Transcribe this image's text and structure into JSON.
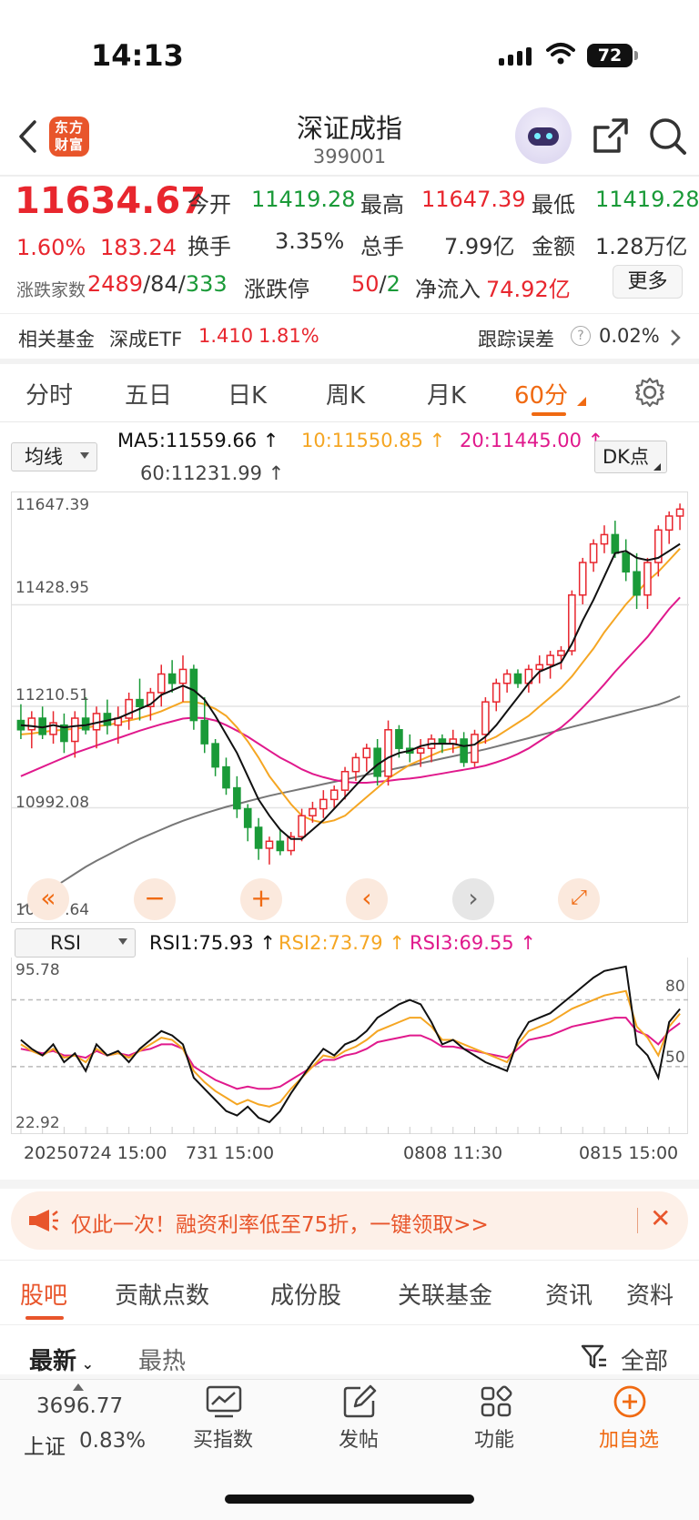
{
  "status": {
    "time": "14:13",
    "battery": "72"
  },
  "nav": {
    "title": "深证成指",
    "code": "399001",
    "logo_line1": "东方",
    "logo_line2": "财富"
  },
  "quote": {
    "price": "11634.67",
    "pct": "1.60%",
    "chg": "183.24",
    "open_label": "今开",
    "open": "11419.28",
    "high_label": "最高",
    "high": "11647.39",
    "low_label": "最低",
    "low": "11419.28",
    "turnover_label": "换手",
    "turnover": "3.35%",
    "volume_label": "总手",
    "volume": "7.99亿",
    "amount_label": "金额",
    "amount": "1.28万亿",
    "breadth_label": "涨跌家数",
    "up": "2489",
    "flat": "84",
    "down": "333",
    "limit_label": "涨跌停",
    "limit_up": "50",
    "limit_down": "2",
    "inflow_label": "净流入",
    "inflow": "74.92亿",
    "more": "更多"
  },
  "fund": {
    "label": "相关基金",
    "name": "深成ETF",
    "price": "1.410",
    "pct": "1.81%",
    "track_label": "跟踪误差",
    "track": "0.02%"
  },
  "tabs": [
    "分时",
    "五日",
    "日K",
    "周K",
    "月K",
    "60分"
  ],
  "active_tab": 5,
  "ma": {
    "selector": "均线",
    "ma5": "MA5:11559.66",
    "ma10": "10:11550.85",
    "ma20": "20:11445.00",
    "ma60": "60:11231.99",
    "dk": "DK点"
  },
  "axis": {
    "y1": "11647.39",
    "y2": "11428.95",
    "y3": "11210.51",
    "y4": "10992.08",
    "y5": "10773.64"
  },
  "rsi": {
    "selector": "RSI",
    "rsi1": "RSI1:75.93",
    "rsi2": "RSI2:73.79",
    "rsi3": "RSI3:69.55",
    "max": "95.78",
    "min": "22.92",
    "level80": "80",
    "level50": "50"
  },
  "dates": {
    "d1": "20250724 15:00",
    "d2": "731 15:00",
    "d3": "0808 11:30",
    "d4": "0815 15:00"
  },
  "banner": {
    "text": "仅此一次！融资利率低至75折，一键领取>>"
  },
  "bottom_tabs": [
    "股吧",
    "贡献点数",
    "成份股",
    "关联基金",
    "资讯",
    "资料"
  ],
  "feed": {
    "latest": "最新",
    "hot": "最热",
    "all": "全部"
  },
  "bottombar": {
    "index_value": "3696.77",
    "index_name": "上证",
    "index_pct": "0.83%",
    "buy": "买指数",
    "post": "发帖",
    "func": "功能",
    "add": "加自选"
  },
  "colors": {
    "up": "#e8262e",
    "down": "#1a9a38",
    "accent": "#f06a12",
    "ma5": "#111111",
    "ma10": "#f5a623",
    "ma20": "#e0198c",
    "ma60": "#777777"
  },
  "chart_data": {
    "type": "candlestick",
    "price_range": [
      10773.64,
      11647.39
    ],
    "ohlc": [
      [
        11180,
        11215,
        11140,
        11160
      ],
      [
        11160,
        11200,
        11120,
        11185
      ],
      [
        11185,
        11210,
        11140,
        11150
      ],
      [
        11150,
        11200,
        11130,
        11175
      ],
      [
        11170,
        11195,
        11110,
        11135
      ],
      [
        11135,
        11200,
        11100,
        11185
      ],
      [
        11185,
        11230,
        11150,
        11160
      ],
      [
        11160,
        11210,
        11120,
        11195
      ],
      [
        11195,
        11225,
        11150,
        11170
      ],
      [
        11170,
        11210,
        11130,
        11185
      ],
      [
        11185,
        11240,
        11160,
        11225
      ],
      [
        11225,
        11270,
        11180,
        11210
      ],
      [
        11210,
        11250,
        11180,
        11240
      ],
      [
        11240,
        11300,
        11210,
        11280
      ],
      [
        11280,
        11310,
        11240,
        11260
      ],
      [
        11260,
        11320,
        11220,
        11290
      ],
      [
        11290,
        11300,
        11160,
        11180
      ],
      [
        11180,
        11230,
        11110,
        11130
      ],
      [
        11130,
        11140,
        11060,
        11080
      ],
      [
        11080,
        11100,
        11020,
        11035
      ],
      [
        11035,
        11060,
        10970,
        10990
      ],
      [
        10990,
        11000,
        10920,
        10950
      ],
      [
        10950,
        10970,
        10880,
        10905
      ],
      [
        10905,
        10930,
        10870,
        10920
      ],
      [
        10920,
        10945,
        10890,
        10900
      ],
      [
        10900,
        10940,
        10890,
        10930
      ],
      [
        10930,
        10990,
        10920,
        10975
      ],
      [
        10975,
        11005,
        10960,
        10990
      ],
      [
        10990,
        11030,
        10970,
        11010
      ],
      [
        11010,
        11040,
        10990,
        11030
      ],
      [
        11030,
        11080,
        11010,
        11070
      ],
      [
        11070,
        11110,
        11050,
        11100
      ],
      [
        11100,
        11130,
        11070,
        11120
      ],
      [
        11120,
        11140,
        11040,
        11060
      ],
      [
        11060,
        11180,
        11040,
        11160
      ],
      [
        11160,
        11170,
        11100,
        11120
      ],
      [
        11120,
        11150,
        11090,
        11110
      ],
      [
        11110,
        11140,
        11080,
        11120
      ],
      [
        11120,
        11150,
        11090,
        11140
      ],
      [
        11140,
        11150,
        11110,
        11130
      ],
      [
        11130,
        11160,
        11110,
        11140
      ],
      [
        11140,
        11155,
        11080,
        11090
      ],
      [
        11090,
        11160,
        11080,
        11150
      ],
      [
        11150,
        11230,
        11130,
        11220
      ],
      [
        11220,
        11270,
        11200,
        11260
      ],
      [
        11260,
        11290,
        11240,
        11280
      ],
      [
        11280,
        11290,
        11250,
        11260
      ],
      [
        11260,
        11300,
        11240,
        11290
      ],
      [
        11290,
        11320,
        11260,
        11300
      ],
      [
        11300,
        11330,
        11270,
        11320
      ],
      [
        11320,
        11340,
        11290,
        11330
      ],
      [
        11330,
        11460,
        11320,
        11450
      ],
      [
        11450,
        11530,
        11430,
        11520
      ],
      [
        11520,
        11570,
        11500,
        11560
      ],
      [
        11560,
        11600,
        11540,
        11580
      ],
      [
        11580,
        11610,
        11530,
        11540
      ],
      [
        11540,
        11570,
        11480,
        11500
      ],
      [
        11500,
        11540,
        11420,
        11450
      ],
      [
        11450,
        11530,
        11420,
        11520
      ],
      [
        11520,
        11600,
        11490,
        11590
      ],
      [
        11590,
        11630,
        11560,
        11620
      ],
      [
        11620,
        11647,
        11590,
        11635
      ]
    ],
    "ma5": [
      11170,
      11168,
      11165,
      11170,
      11165,
      11168,
      11170,
      11175,
      11180,
      11185,
      11195,
      11205,
      11215,
      11235,
      11245,
      11255,
      11245,
      11225,
      11190,
      11150,
      11110,
      11060,
      11010,
      10975,
      10945,
      10925,
      10925,
      10945,
      10965,
      10990,
      11015,
      11040,
      11065,
      11085,
      11100,
      11110,
      11115,
      11125,
      11130,
      11130,
      11130,
      11125,
      11128,
      11145,
      11170,
      11200,
      11230,
      11260,
      11285,
      11295,
      11305,
      11345,
      11395,
      11440,
      11490,
      11540,
      11545,
      11530,
      11525,
      11530,
      11545,
      11560
    ],
    "ma10": [
      11150,
      11152,
      11155,
      11158,
      11160,
      11162,
      11165,
      11168,
      11170,
      11175,
      11180,
      11185,
      11192,
      11200,
      11210,
      11220,
      11220,
      11215,
      11205,
      11190,
      11165,
      11135,
      11100,
      11060,
      11030,
      11000,
      10975,
      10965,
      10960,
      10965,
      10975,
      10995,
      11015,
      11035,
      11055,
      11070,
      11085,
      11095,
      11105,
      11115,
      11120,
      11125,
      11128,
      11135,
      11145,
      11160,
      11175,
      11190,
      11210,
      11230,
      11250,
      11275,
      11305,
      11335,
      11370,
      11400,
      11430,
      11455,
      11480,
      11500,
      11525,
      11550
    ],
    "ma20": [
      11060,
      11070,
      11080,
      11090,
      11100,
      11110,
      11118,
      11126,
      11134,
      11142,
      11150,
      11158,
      11165,
      11172,
      11178,
      11184,
      11186,
      11185,
      11180,
      11170,
      11158,
      11145,
      11130,
      11115,
      11100,
      11088,
      11075,
      11065,
      11058,
      11052,
      11048,
      11046,
      11046,
      11048,
      11050,
      11053,
      11055,
      11058,
      11062,
      11066,
      11070,
      11074,
      11078,
      11083,
      11090,
      11098,
      11108,
      11120,
      11135,
      11150,
      11165,
      11185,
      11208,
      11232,
      11258,
      11285,
      11310,
      11335,
      11360,
      11390,
      11420,
      11445
    ],
    "ma60": [
      10775,
      10790,
      10805,
      10820,
      10835,
      10850,
      10865,
      10878,
      10890,
      10902,
      10914,
      10925,
      10935,
      10945,
      10955,
      10964,
      10972,
      10980,
      10987,
      10994,
      11000,
      11006,
      11012,
      11018,
      11023,
      11028,
      11033,
      11038,
      11043,
      11048,
      11053,
      11058,
      11063,
      11068,
      11073,
      11078,
      11083,
      11088,
      11093,
      11098,
      11103,
      11108,
      11113,
      11118,
      11124,
      11130,
      11136,
      11142,
      11148,
      11154,
      11160,
      11166,
      11172,
      11178,
      11184,
      11190,
      11196,
      11202,
      11208,
      11214,
      11222,
      11232
    ],
    "rsi_range": [
      22.92,
      95.78
    ],
    "rsi1": [
      62,
      58,
      55,
      60,
      52,
      56,
      48,
      60,
      55,
      57,
      52,
      58,
      62,
      66,
      64,
      60,
      45,
      40,
      35,
      30,
      28,
      32,
      27,
      25,
      30,
      38,
      45,
      52,
      58,
      55,
      60,
      62,
      66,
      72,
      75,
      78,
      80,
      78,
      70,
      60,
      62,
      58,
      55,
      52,
      50,
      48,
      62,
      70,
      72,
      74,
      78,
      82,
      86,
      90,
      93,
      94,
      95,
      60,
      55,
      45,
      70,
      75.93
    ],
    "rsi2": [
      60,
      57,
      55,
      58,
      54,
      55,
      52,
      58,
      55,
      56,
      54,
      57,
      60,
      63,
      62,
      58,
      48,
      43,
      39,
      36,
      33,
      35,
      33,
      32,
      34,
      40,
      45,
      50,
      55,
      54,
      57,
      59,
      62,
      66,
      68,
      70,
      72,
      72,
      68,
      62,
      62,
      60,
      58,
      56,
      54,
      52,
      60,
      66,
      68,
      70,
      73,
      76,
      78,
      80,
      82,
      83,
      84,
      68,
      63,
      55,
      68,
      73.79
    ],
    "rsi3": [
      58,
      57,
      56,
      57,
      55,
      55,
      54,
      57,
      55,
      56,
      55,
      57,
      58,
      60,
      60,
      58,
      50,
      47,
      44,
      42,
      40,
      41,
      40,
      40,
      41,
      44,
      47,
      50,
      53,
      53,
      55,
      56,
      58,
      61,
      62,
      63,
      64,
      64,
      62,
      59,
      59,
      58,
      57,
      56,
      55,
      54,
      58,
      62,
      63,
      64,
      66,
      68,
      69,
      70,
      71,
      72,
      72,
      66,
      64,
      60,
      66,
      69.55
    ]
  }
}
